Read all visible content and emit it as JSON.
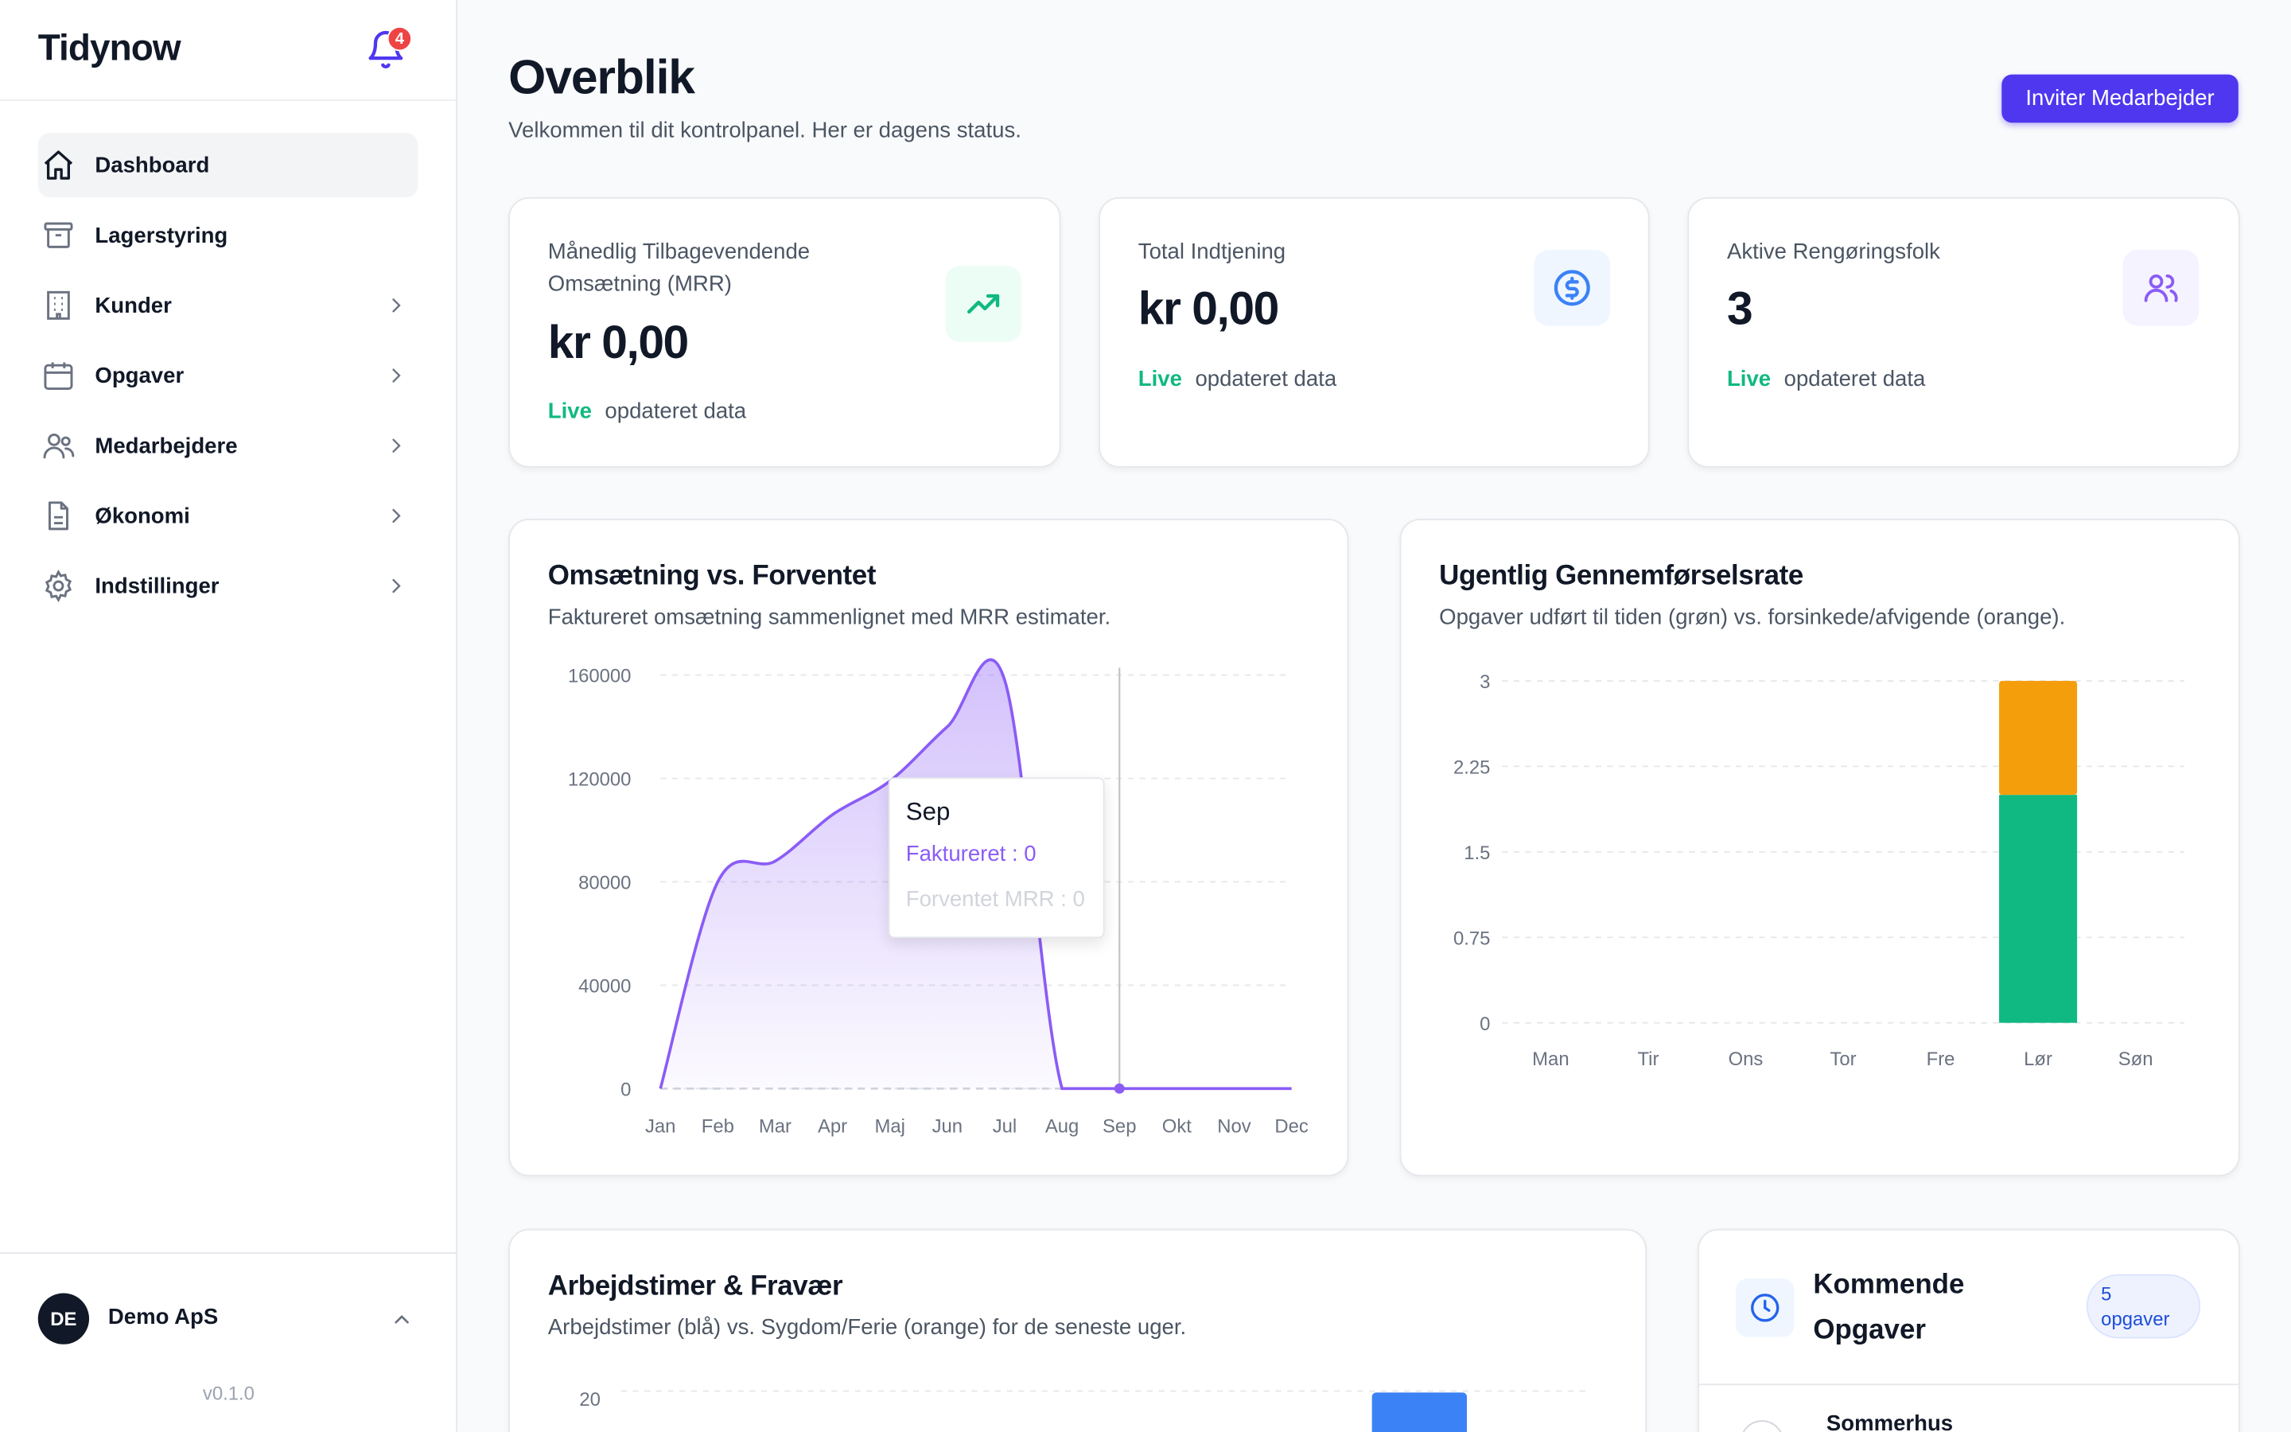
{
  "sidebar": {
    "brand": "Tidynow",
    "notifications_count": "4",
    "items": [
      {
        "label": "Dashboard"
      },
      {
        "label": "Lagerstyring"
      },
      {
        "label": "Kunder"
      },
      {
        "label": "Opgaver"
      },
      {
        "label": "Medarbejdere"
      },
      {
        "label": "Økonomi"
      },
      {
        "label": "Indstillinger"
      }
    ],
    "org": {
      "initials": "DE",
      "name": "Demo ApS"
    },
    "version": "v0.1.0"
  },
  "header": {
    "title": "Overblik",
    "subtitle": "Velkommen til dit kontrolpanel. Her er dagens status.",
    "invite_label": "Inviter Medarbejder"
  },
  "stats": [
    {
      "label": "Månedlig Tilbagevendende Omsætning (MRR)",
      "value": "kr 0,00",
      "live": "Live",
      "foot": "opdateret data",
      "icon": "trending-up-icon",
      "accent": "#10b981"
    },
    {
      "label": "Total Indtjening",
      "value": "kr 0,00",
      "live": "Live",
      "foot": "opdateret data",
      "icon": "dollar-circle-icon",
      "accent": "#3b82f6"
    },
    {
      "label": "Aktive Rengøringsfolk",
      "value": "3",
      "live": "Live",
      "foot": "opdateret data",
      "icon": "users-icon",
      "accent": "#8b5cf6"
    }
  ],
  "revenue_card": {
    "title": "Omsætning vs. Forventet",
    "subtitle": "Faktureret omsætning sammenlignet med MRR estimater.",
    "tooltip": {
      "label": "Sep",
      "line1": "Faktureret : 0",
      "line2": "Forventet MRR : 0"
    }
  },
  "rate_card": {
    "title": "Ugentlig Gennemførselsrate",
    "subtitle": "Opgaver udført til tiden (grøn) vs. forsinkede/afvigende (orange)."
  },
  "hours_card": {
    "title": "Arbejdstimer & Fravær",
    "subtitle": "Arbejdstimer (blå) vs. Sygdom/Ferie (orange) for de seneste uger."
  },
  "upcoming_card": {
    "title": "Kommende Opgaver",
    "count": "5",
    "count_label": "opgaver",
    "first_item": "Sommerhus"
  },
  "chart_data": [
    {
      "type": "area",
      "categories": [
        "Jan",
        "Feb",
        "Mar",
        "Apr",
        "Maj",
        "Jun",
        "Jul",
        "Aug",
        "Sep",
        "Okt",
        "Nov",
        "Dec"
      ],
      "series": [
        {
          "name": "Faktureret",
          "values": [
            0,
            80000,
            88000,
            106000,
            119000,
            140000,
            158000,
            0,
            0,
            0,
            0,
            0
          ],
          "color": "#8b5cf6"
        },
        {
          "name": "Forventet MRR",
          "values": [
            0,
            0,
            0,
            0,
            0,
            0,
            0,
            0,
            0,
            0,
            0,
            0
          ],
          "color": "#d1d5db"
        }
      ],
      "yticks": [
        0,
        40000,
        80000,
        120000,
        160000
      ],
      "ylim": [
        0,
        160000
      ],
      "highlight": "Sep",
      "grid": true
    },
    {
      "type": "bar",
      "stacked": true,
      "categories": [
        "Man",
        "Tir",
        "Ons",
        "Tor",
        "Fre",
        "Lør",
        "Søn"
      ],
      "series": [
        {
          "name": "Til tiden",
          "values": [
            0,
            0,
            0,
            0,
            0,
            2,
            0
          ],
          "color": "#10b981"
        },
        {
          "name": "Forsinket",
          "values": [
            0,
            0,
            0,
            0,
            0,
            1,
            0
          ],
          "color": "#f59e0b"
        }
      ],
      "yticks": [
        "0",
        "0.75",
        "1.5",
        "2.25",
        "3"
      ],
      "ylim": [
        0,
        3
      ],
      "grid": true
    },
    {
      "type": "bar",
      "visible_ytick": "20",
      "bar_color": "#3b82f6"
    }
  ]
}
